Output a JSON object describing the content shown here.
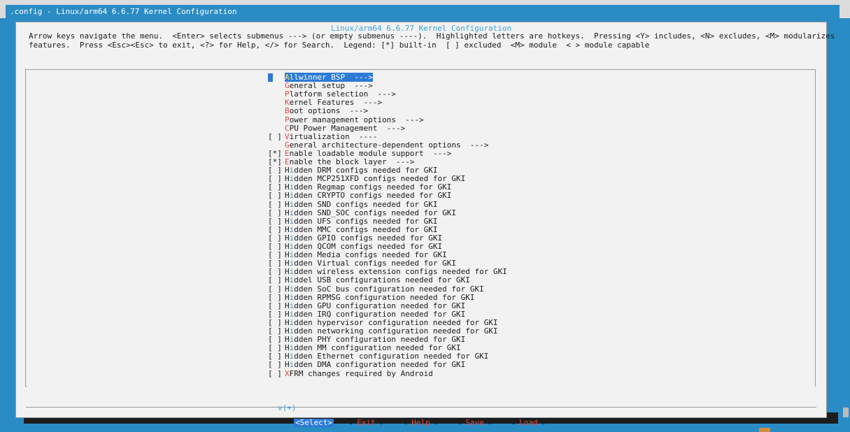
{
  "window": {
    "title": ".config - Linux/arm64 6.6.77 Kernel Configuration"
  },
  "dialog": {
    "title": "Linux/arm64 6.6.77 Kernel Configuration",
    "help_line1": "Arrow keys navigate the menu.  <Enter> selects submenus ---> (or empty submenus ----).  Highlighted letters are hotkeys.  Pressing <Y> includes, <N> excludes, <M> modularizes",
    "help_line2": "features.  Press <Esc><Esc> to exit, <?> for Help, </> for Search.  Legend: [*] built-in  [ ] excluded  <M> module  < > module capable"
  },
  "menu": {
    "items": [
      {
        "mark": "",
        "hot": "A",
        "rest": "llwinner BSP  --->",
        "selected": true
      },
      {
        "mark": "",
        "hot": "G",
        "rest": "eneral setup  --->"
      },
      {
        "mark": "",
        "hot": "P",
        "rest": "latform selection  --->"
      },
      {
        "mark": "",
        "hot": "K",
        "rest": "ernel Features  --->"
      },
      {
        "mark": "",
        "hot": "B",
        "rest": "oot options  --->"
      },
      {
        "mark": "",
        "hot": "P",
        "rest": "ower management options  --->"
      },
      {
        "mark": "",
        "hot": "C",
        "rest": "PU Power Management  --->"
      },
      {
        "mark": "[ ]",
        "hot": "V",
        "rest": "irtualization  ----"
      },
      {
        "mark": "",
        "hot": "G",
        "rest": "eneral architecture-dependent options  --->"
      },
      {
        "mark": "[*]",
        "hot": "E",
        "rest": "nable loadable module support  --->"
      },
      {
        "mark": "[*]",
        "hot": "E",
        "rest": "nable the block layer  --->"
      },
      {
        "mark": "[ ]",
        "pre": "H",
        "hot": "i",
        "rest": "dden DRM configs needed for GKI"
      },
      {
        "mark": "[ ]",
        "pre": "H",
        "hot": "i",
        "rest": "dden MCP251XFD configs needed for GKI"
      },
      {
        "mark": "[ ]",
        "pre": "H",
        "hot": "i",
        "rest": "dden Regmap configs needed for GKI"
      },
      {
        "mark": "[ ]",
        "pre": "H",
        "hot": "i",
        "rest": "dden CRYPTO configs needed for GKI"
      },
      {
        "mark": "[ ]",
        "pre": "H",
        "hot": "i",
        "rest": "dden SND configs needed for GKI"
      },
      {
        "mark": "[ ]",
        "pre": "H",
        "hot": "i",
        "rest": "dden SND_SOC configs needed for GKI"
      },
      {
        "mark": "[ ]",
        "pre": "H",
        "hot": "i",
        "rest": "dden UFS configs needed for GKI"
      },
      {
        "mark": "[ ]",
        "pre": "H",
        "hot": "i",
        "rest": "dden MMC configs needed for GKI"
      },
      {
        "mark": "[ ]",
        "pre": "H",
        "hot": "i",
        "rest": "dden GPIO configs needed for GKI"
      },
      {
        "mark": "[ ]",
        "pre": "H",
        "hot": "i",
        "rest": "dden QCOM configs needed for GKI"
      },
      {
        "mark": "[ ]",
        "pre": "H",
        "hot": "i",
        "rest": "dden Media configs needed for GKI"
      },
      {
        "mark": "[ ]",
        "pre": "H",
        "hot": "i",
        "rest": "dden Virtual configs needed for GKI"
      },
      {
        "mark": "[ ]",
        "pre": "H",
        "hot": "i",
        "rest": "dden wireless extension configs needed for GKI"
      },
      {
        "mark": "[ ]",
        "pre": "H",
        "hot": "i",
        "rest": "ddel USB configurations needed for GKI"
      },
      {
        "mark": "[ ]",
        "pre": "H",
        "hot": "i",
        "rest": "dden SoC bus configuration needed for GKI"
      },
      {
        "mark": "[ ]",
        "pre": "H",
        "hot": "i",
        "rest": "dden RPMSG configuration needed for GKI"
      },
      {
        "mark": "[ ]",
        "pre": "H",
        "hot": "i",
        "rest": "dden GPU configuration needed for GKI"
      },
      {
        "mark": "[ ]",
        "pre": "H",
        "hot": "i",
        "rest": "dden IRQ configuration needed for GKI"
      },
      {
        "mark": "[ ]",
        "pre": "H",
        "hot": "i",
        "rest": "dden hypervisor configuration needed for GKI"
      },
      {
        "mark": "[ ]",
        "pre": "H",
        "hot": "i",
        "rest": "dden networking configuration needed for GKI"
      },
      {
        "mark": "[ ]",
        "pre": "H",
        "hot": "i",
        "rest": "dden PHY configuration needed for GKI"
      },
      {
        "mark": "[ ]",
        "pre": "H",
        "hot": "i",
        "rest": "dden MM configuration needed for GKI"
      },
      {
        "mark": "[ ]",
        "pre": "H",
        "hot": "i",
        "rest": "dden Ethernet configuration needed for GKI"
      },
      {
        "mark": "[ ]",
        "pre": "H",
        "hot": "i",
        "rest": "dden DMA configuration needed for GKI"
      },
      {
        "mark": "[ ]",
        "hot": "X",
        "rest": "FRM changes required by Android"
      }
    ],
    "more_indicator": "v(+)"
  },
  "buttons": {
    "select": "Select",
    "exit": "Exit",
    "help": "Help",
    "save": "Save",
    "load": "Load"
  },
  "colors": {
    "background": "#2a8cc4",
    "dialog": "#f2f2f2",
    "selection": "#2d7bd6",
    "hotkey": "#e04848"
  }
}
